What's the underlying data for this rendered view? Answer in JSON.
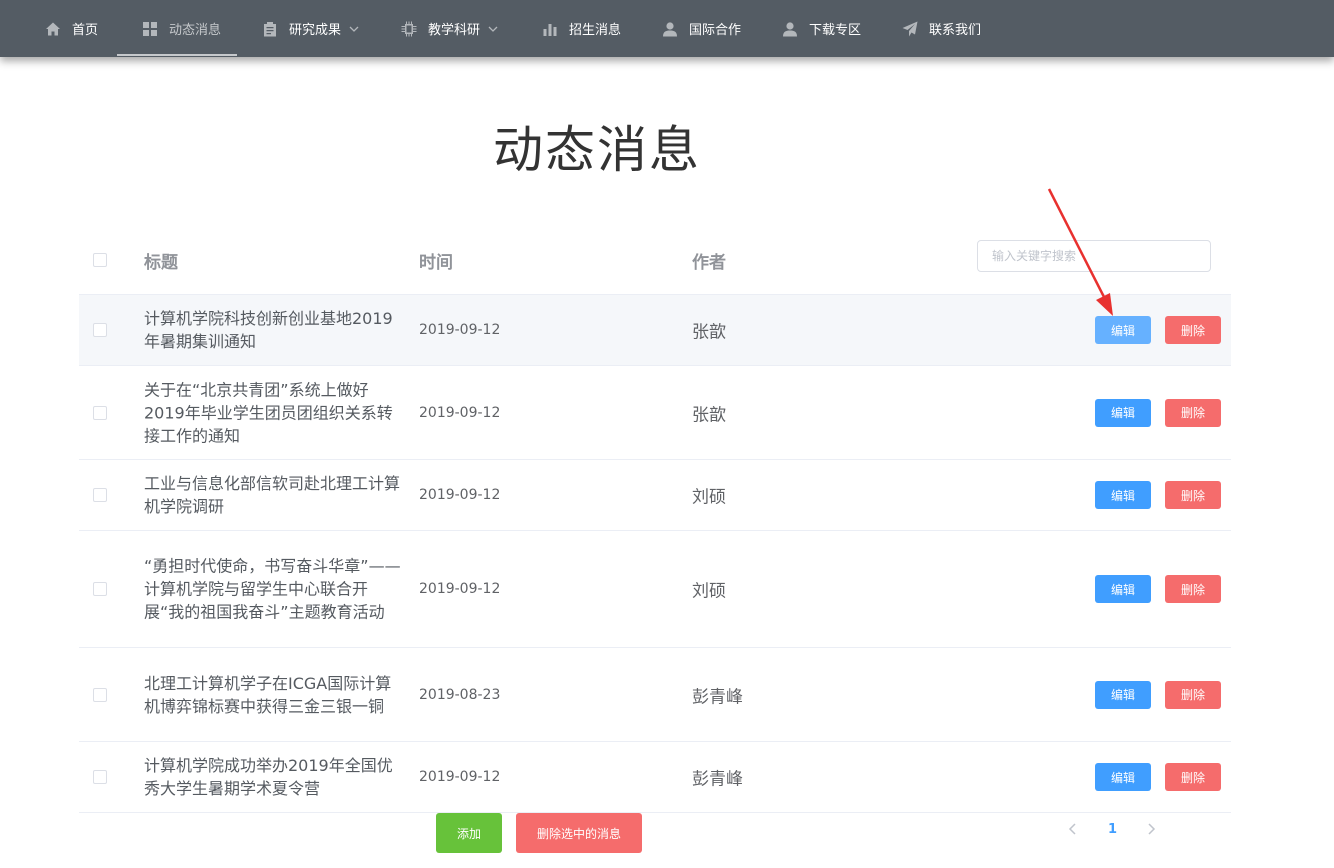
{
  "nav": {
    "items": [
      {
        "label": "首页",
        "icon": "home-icon"
      },
      {
        "label": "动态消息",
        "icon": "grid-icon"
      },
      {
        "label": "研究成果",
        "icon": "clipboard-icon"
      },
      {
        "label": "教学科研",
        "icon": "cpu-icon"
      },
      {
        "label": "招生消息",
        "icon": "bar-chart-icon"
      },
      {
        "label": "国际合作",
        "icon": "user-icon"
      },
      {
        "label": "下载专区",
        "icon": "user-icon"
      },
      {
        "label": "联系我们",
        "icon": "send-icon"
      }
    ],
    "active": "动态消息",
    "background": "#545c64"
  },
  "page_title": "动态消息",
  "table": {
    "headers": {
      "title": "标题",
      "date": "时间",
      "author": "作者"
    },
    "search_placeholder": "输入关键字搜索",
    "edit_label": "编辑",
    "delete_label": "删除",
    "rows": [
      {
        "title": "计算机学院科技创新创业基地2019年暑期集训通知",
        "date": "2019-09-12",
        "author": "张歆"
      },
      {
        "title": "关于在“北京共青团”系统上做好2019年毕业学生团员团组织关系转接工作的通知",
        "date": "2019-09-12",
        "author": "张歆"
      },
      {
        "title": "工业与信息化部信软司赴北理工计算机学院调研",
        "date": "2019-09-12",
        "author": "刘硕"
      },
      {
        "title": "“勇担时代使命，书写奋斗华章”——计算机学院与留学生中心联合开展“我的祖国我奋斗”主题教育活动",
        "date": "2019-09-12",
        "author": "刘硕"
      },
      {
        "title": "北理工计算机学子在ICGA国际计算机博弈锦标赛中获得三金三银一铜",
        "date": "2019-08-23",
        "author": "彭青峰"
      },
      {
        "title": "计算机学院成功举办2019年全国优秀大学生暑期学术夏令营",
        "date": "2019-09-12",
        "author": "彭青峰"
      }
    ]
  },
  "actions": {
    "add_label": "添加",
    "delete_selected_label": "删除选中的消息"
  },
  "pagination": {
    "current_page": "1"
  },
  "colors": {
    "primary": "#409eff",
    "danger": "#f56c6c",
    "success": "#67c23a",
    "annotation": "#e8312f"
  }
}
